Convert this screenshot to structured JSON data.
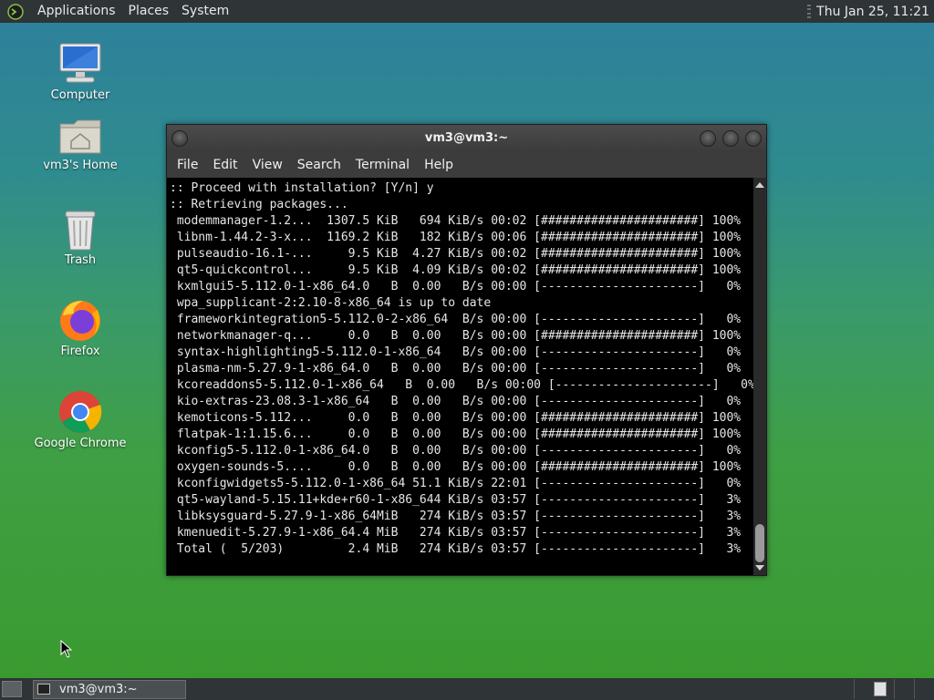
{
  "top_panel": {
    "menus": [
      "Applications",
      "Places",
      "System"
    ],
    "clock": "Thu Jan 25, 11:21"
  },
  "desktop_icons": [
    {
      "label": "Computer",
      "icon": "computer-icon"
    },
    {
      "label": "vm3's Home",
      "icon": "home-folder-icon"
    },
    {
      "label": "Trash",
      "icon": "trash-icon"
    },
    {
      "label": "Firefox",
      "icon": "firefox-icon"
    },
    {
      "label": "Google Chrome",
      "icon": "chrome-icon"
    }
  ],
  "window": {
    "title": "vm3@vm3:~",
    "menu": [
      "File",
      "Edit",
      "View",
      "Search",
      "Terminal",
      "Help"
    ]
  },
  "terminal": {
    "lines": [
      ":: Proceed with installation? [Y/n] y",
      ":: Retrieving packages...",
      " modemmanager-1.2...  1307.5 KiB   694 KiB/s 00:02 [######################] 100%",
      " libnm-1.44.2-3-x...  1169.2 KiB   182 KiB/s 00:06 [######################] 100%",
      " pulseaudio-16.1-...     9.5 KiB  4.27 KiB/s 00:02 [######################] 100%",
      " qt5-quickcontrol...     9.5 KiB  4.09 KiB/s 00:02 [######################] 100%",
      " kxmlgui5-5.112.0-1-x86_64.0   B  0.00   B/s 00:00 [----------------------]   0%",
      " wpa_supplicant-2:2.10-8-x86_64 is up to date",
      " frameworkintegration5-5.112.0-2-x86_64  B/s 00:00 [----------------------]   0%",
      " networkmanager-q...     0.0   B  0.00   B/s 00:00 [######################] 100%",
      " syntax-highlighting5-5.112.0-1-x86_64   B/s 00:00 [----------------------]   0%",
      " plasma-nm-5.27.9-1-x86_64.0   B  0.00   B/s 00:00 [----------------------]   0%",
      " kcoreaddons5-5.112.0-1-x86_64   B  0.00   B/s 00:00 [----------------------]   0%",
      " kio-extras-23.08.3-1-x86_64   B  0.00   B/s 00:00 [----------------------]   0%",
      " kemoticons-5.112...     0.0   B  0.00   B/s 00:00 [######################] 100%",
      " flatpak-1:1.15.6...     0.0   B  0.00   B/s 00:00 [######################] 100%",
      " kconfig5-5.112.0-1-x86_64.0   B  0.00   B/s 00:00 [----------------------]   0%",
      " oxygen-sounds-5....     0.0   B  0.00   B/s 00:00 [######################] 100%",
      " kconfigwidgets5-5.112.0-1-x86_64 51.1 KiB/s 22:01 [----------------------]   0%",
      " qt5-wayland-5.15.11+kde+r60-1-x86_644 KiB/s 03:57 [----------------------]   3%",
      " libksysguard-5.27.9-1-x86_64MiB   274 KiB/s 03:57 [----------------------]   3%",
      " kmenuedit-5.27.9-1-x86_64.4 MiB   274 KiB/s 03:57 [----------------------]   3%",
      " Total (  5/203)         2.4 MiB   274 KiB/s 03:57 [----------------------]   3%"
    ]
  },
  "taskbar": {
    "task_label": "vm3@vm3:~"
  }
}
